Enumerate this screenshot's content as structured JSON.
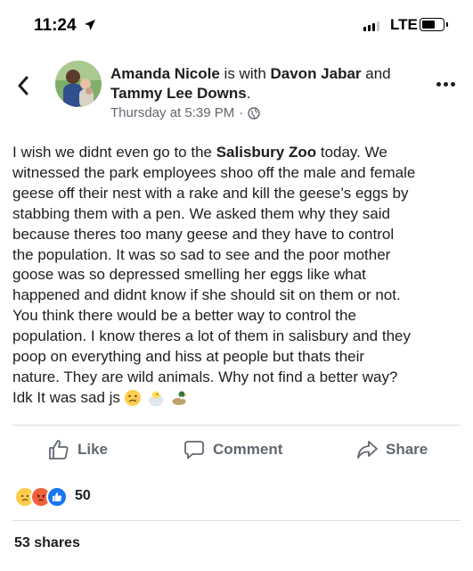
{
  "status_bar": {
    "time": "11:24",
    "network": "LTE"
  },
  "header": {
    "author": "Amanda Nicole",
    "with_text": " is with ",
    "tagged_1": "Davon Jabar",
    "and_text": " and",
    "tagged_2": "Tammy Lee Downs",
    "period": ".",
    "timestamp": "Thursday at 5:39 PM",
    "separator": "·",
    "audience_icon": "globe-icon"
  },
  "post": {
    "part_1": "I wish we didnt even go to the ",
    "bold_place": "Salisbury Zoo",
    "part_2": " today. We\nwitnessed the park employees shoo off the male and female\ngeese off their nest with a rake and kill the geese’s eggs by\nstabbing them with a pen. We asked them why they said\nbecause theres too many geese and they have to control\nthe population. It was so sad to see and the poor mother\ngoose was so depressed smelling her eggs like what\nhappened and didnt know if she should sit on them or not.\nYou think there would be a better way to control the\npopulation. I know theres a lot of them in salisbury and they\npoop on everything and hiss at people but thats their\nnature. They are wild animals. Why not find a better way?\nIdk It was sad js",
    "emojis": [
      "crying-face-emoji",
      "hatching-chick-emoji",
      "duck-emoji"
    ]
  },
  "actions": {
    "like": "Like",
    "comment": "Comment",
    "share": "Share"
  },
  "reactions": {
    "icons": [
      "sad-reaction-icon",
      "angry-reaction-icon",
      "like-reaction-icon"
    ],
    "count": "50"
  },
  "shares_text": "53 shares",
  "colors": {
    "text": "#1c1e21",
    "secondary": "#606770",
    "divider": "#dadde1",
    "like_blue": "#1877f2"
  }
}
